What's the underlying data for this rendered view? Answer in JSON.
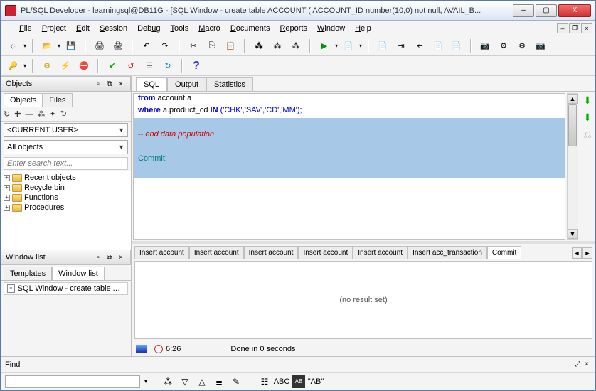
{
  "window": {
    "title": "PL/SQL Developer - learningsql@DB11G - [SQL Window - create table ACCOUNT ( ACCOUNT_ID number(10,0) not null, AVAIL_B...",
    "min": "–",
    "max": "▢",
    "close": "X"
  },
  "menu": {
    "file": "File",
    "project": "Project",
    "edit": "Edit",
    "session": "Session",
    "debug": "Debug",
    "tools": "Tools",
    "macro": "Macro",
    "documents": "Documents",
    "reports": "Reports",
    "window": "Window",
    "help": "Help"
  },
  "left": {
    "objects_hdr": "Objects",
    "tab_objects": "Objects",
    "tab_files": "Files",
    "current_user": "<CURRENT USER>",
    "all_objects": "All objects",
    "search_placeholder": "Enter search text...",
    "tree": [
      "Recent objects",
      "Recycle bin",
      "Functions",
      "Procedures"
    ],
    "windowlist_hdr": "Window list",
    "tab_templates": "Templates",
    "tab_windowlist": "Window list",
    "win_item": "SQL Window - create table ACCOU"
  },
  "editor": {
    "tabs": {
      "sql": "SQL",
      "output": "Output",
      "statistics": "Statistics"
    },
    "line1_from": "from",
    "line1_rest": " account a",
    "line2_where": "where",
    "line2_mid": " a.product_cd ",
    "line2_in": "IN",
    "line2_args": " ('CHK','SAV','CD','MM');",
    "line4": "-- end data population",
    "line6_commit": "Commit",
    "line6_semi": ";"
  },
  "results": {
    "tabs": [
      "Insert account",
      "Insert account",
      "Insert account",
      "Insert account",
      "Insert account",
      "Insert acc_transaction",
      "Commit"
    ],
    "body": "(no result set)"
  },
  "status": {
    "time": "6:26",
    "msg": "Done in 0 seconds"
  },
  "find": {
    "label": "Find",
    "ab": "\"AB\"",
    "abc": "ABC"
  }
}
